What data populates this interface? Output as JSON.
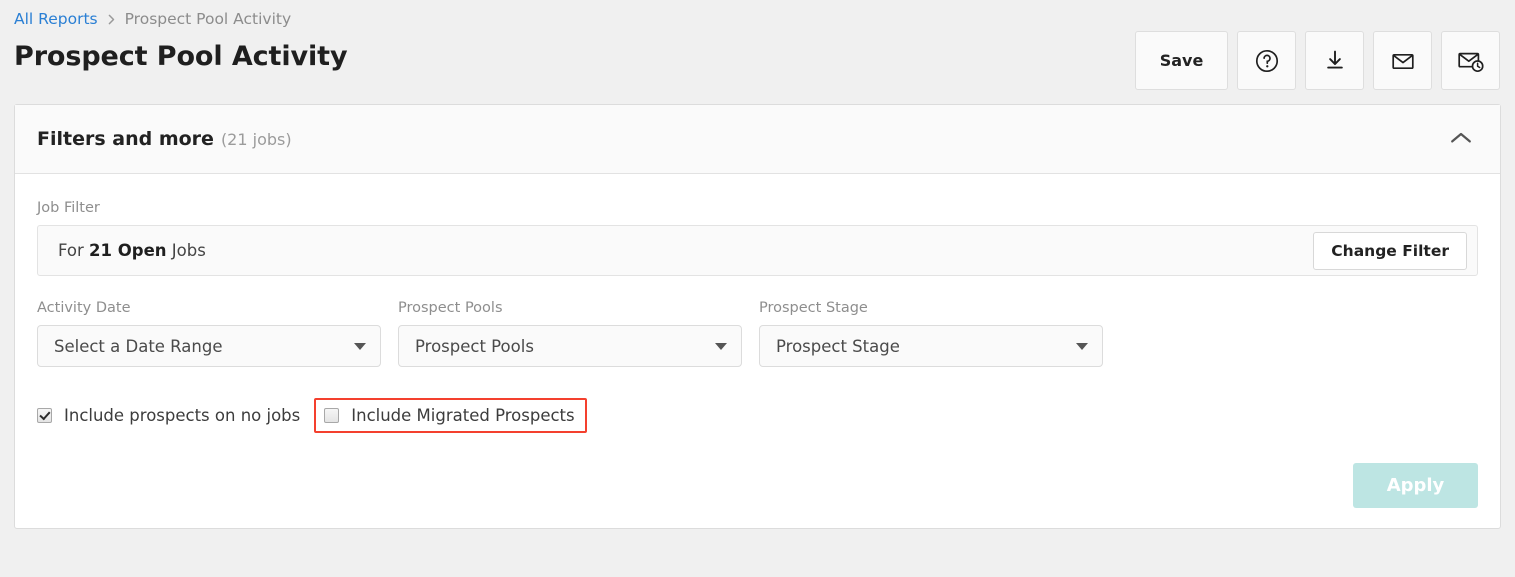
{
  "breadcrumb": {
    "link_label": "All Reports",
    "separator": "›",
    "current_label": "Prospect Pool Activity"
  },
  "page": {
    "title": "Prospect Pool Activity"
  },
  "header_actions": {
    "save_label": "Save",
    "help_icon": "question-circle-icon",
    "download_icon": "download-icon",
    "email_icon": "envelope-icon",
    "schedule_email_icon": "envelope-clock-icon"
  },
  "filters_card": {
    "title": "Filters and more",
    "count_label": "(21 jobs)",
    "collapse_icon": "chevron-up-icon"
  },
  "job_filter": {
    "label": "Job Filter",
    "text_prefix": "For ",
    "text_strong": "21 Open",
    "text_suffix": " Jobs",
    "change_filter_label": "Change Filter"
  },
  "dropdowns": [
    {
      "label": "Activity Date",
      "value": "Select a Date Range",
      "caret_icon": "chevron-down-icon"
    },
    {
      "label": "Prospect Pools",
      "value": "Prospect Pools",
      "caret_icon": "chevron-down-icon"
    },
    {
      "label": "Prospect Stage",
      "value": "Prospect Stage",
      "caret_icon": "chevron-down-icon"
    }
  ],
  "checkboxes": [
    {
      "label": "Include prospects on no jobs",
      "checked": true,
      "highlighted": false
    },
    {
      "label": "Include Migrated Prospects",
      "checked": false,
      "highlighted": true
    }
  ],
  "apply": {
    "label": "Apply",
    "disabled": true
  },
  "colors": {
    "page_background": "#f0f0f0",
    "card_background": "#ffffff",
    "card_header_background": "#fafafa",
    "link_blue": "#2a7fd4",
    "muted_text": "#8e8e8e",
    "apply_disabled": "#bde5e3",
    "highlight_outline": "#f4402e"
  }
}
